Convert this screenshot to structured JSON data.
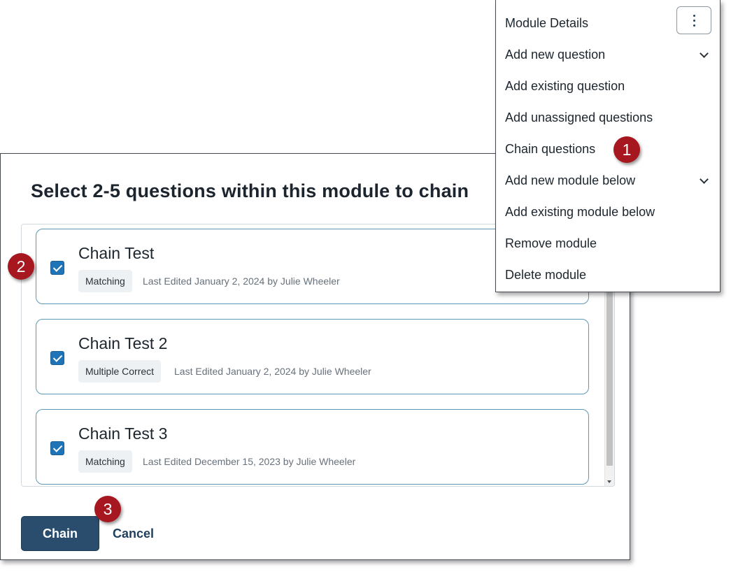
{
  "modal": {
    "title": "Select 2-5 questions within this module to chain",
    "questions": [
      {
        "title": "Chain Test",
        "type": "Matching",
        "meta": "Last Edited January 2, 2024 by Julie Wheeler",
        "checked": true
      },
      {
        "title": "Chain Test 2",
        "type": "Multiple Correct",
        "meta": "Last Edited January 2, 2024 by Julie Wheeler",
        "checked": true
      },
      {
        "title": "Chain Test 3",
        "type": "Matching",
        "meta": "Last Edited December 15, 2023 by Julie Wheeler",
        "checked": true
      }
    ],
    "chain_label": "Chain",
    "cancel_label": "Cancel"
  },
  "menu": {
    "items": [
      {
        "label": "Module Details"
      },
      {
        "label": "Add new question",
        "has_submenu": true
      },
      {
        "label": "Add existing question"
      },
      {
        "label": "Add unassigned questions"
      },
      {
        "label": "Chain questions"
      },
      {
        "label": "Add new module below",
        "has_submenu": true
      },
      {
        "label": "Add existing module below"
      },
      {
        "label": "Remove module"
      },
      {
        "label": "Delete module"
      }
    ],
    "kebab_icon": "vertical-ellipsis-icon"
  },
  "callouts": [
    "1",
    "2",
    "3"
  ],
  "colors": {
    "primary": "#2a4d6e",
    "checkbox": "#1f73b7",
    "card_border": "#5f98b5",
    "callout": "#a6171f"
  }
}
